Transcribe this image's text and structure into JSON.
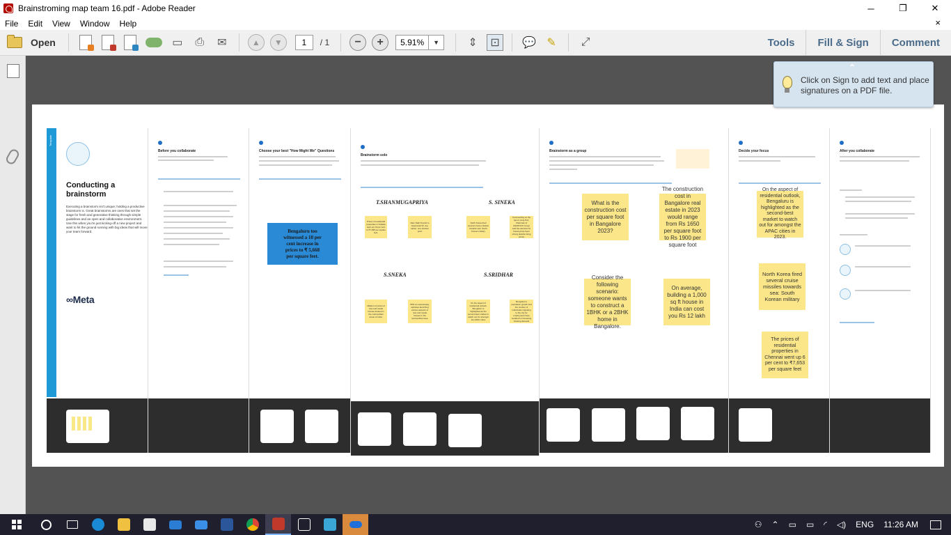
{
  "window": {
    "title": "Brainstroming map team 16.pdf - Adobe Reader",
    "minimize": "─",
    "maximize": "❐",
    "close": "✕"
  },
  "menu": {
    "items": [
      "File",
      "Edit",
      "View",
      "Window",
      "Help"
    ],
    "close_doc": "×"
  },
  "toolbar": {
    "open_label": "Open",
    "page_current": "1",
    "page_total": "/ 1",
    "zoom": "5.91%",
    "tabs": [
      "Tools",
      "Fill & Sign",
      "Comment"
    ]
  },
  "tooltip": {
    "message": "Click on Sign to add text and place signatures on a PDF file."
  },
  "board": {
    "intro": {
      "strip_label": "Template",
      "title": "Conducting a brainstorm",
      "body": "Executing a brainstorm isn't unique; holding a productive brainstorm is. Great brainstorms are ones that set the stage for fresh and generative thinking through simple guidelines and an open and collaborative environment. Use this when you're just kicking-off a new project and want to hit the ground running with big ideas that will move your team forward.",
      "meta": "∞Meta"
    },
    "sections": [
      {
        "title": "Before you collaborate"
      },
      {
        "title": "Choose your best \"How Might We\" Questions"
      },
      {
        "title": "Brainstorm solo"
      },
      {
        "title": "Brainstorm as a group"
      },
      {
        "title": "Decide your focus"
      },
      {
        "title": "After you collaborate"
      }
    ],
    "hmw_box": "Bengaluru too witnessed a 10 per cent increase in prices to ₹ 5,668 per square feet.",
    "names": [
      "T.SHANMUGAPRIYA",
      "S. SINEKA",
      "S.SNEKA",
      "S.SRIDHAR"
    ],
    "solo_notes": [
      "Prices of residential properties in Kolkata went up 10 per cent to ₹7,095 per square feet.",
      "Ram Nath Kovind to lead panel for one nation, one election push",
      "North Korea fired several cruise missiles towards sea: South Korean military",
      "Commenting on the report, Anuj Puri, Chairman of ANAROCK Group said the demand for housing has been strong despite rising prices",
      "inflation of prices of new and resale houses located in the metropolitan areas of India.",
      "With an expressway, websites launching various aspects of new and resale houses in the metropolitan area.",
      "On the aspect of residential outlook, Bengaluru is highlighted as the second-best market to watch out for amongst the APAC cities",
      "Bengaluru's population growth and the number of individuals migrating to the city for employment have resulted in increasing housing demand"
    ],
    "group_notes": [
      "What is the construction cost per square foot in Bangalore 2023?",
      "The construction cost in Bangalore real estate in 2023 would range from Rs 1650 per square foot to Rs 1900 per square foot",
      "Consider the following scenario: someone wants to construct a 1BHK or a 2BHK home in Bangalore.",
      "On average, building a 1,000 sq ft house in India can cost you Rs 12 lakh"
    ],
    "focus_notes": [
      "On the aspect of residential outlook, Bengaluru is highlighted as the second-best market to watch out for amongst the APAC cities in 2023.",
      "North Korea fired several cruise missiles towards sea: South Korean military",
      "The prices of residential properties in Chennai went up 6 per cent to ₹7,653 per square feet"
    ]
  },
  "taskbar": {
    "language": "ENG",
    "time": "11:26 AM"
  },
  "colors": {
    "sticky": "#fbe78a",
    "accent_blue": "#1e9bd7",
    "doc_bg": "#535353"
  }
}
